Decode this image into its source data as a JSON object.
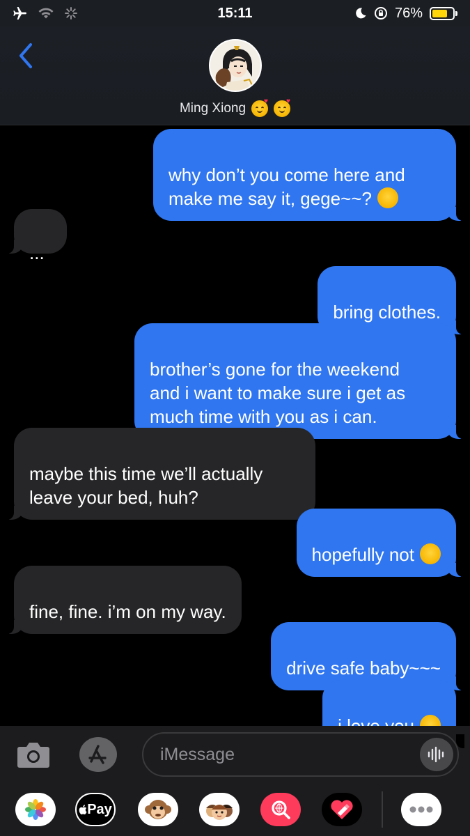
{
  "status_bar": {
    "time": "15:11",
    "battery_percent": "76%",
    "battery_level": 0.76,
    "icons": [
      "airplane-icon",
      "wifi-icon",
      "activity-spinner-icon",
      "moon-icon",
      "orientation-lock-icon",
      "battery-icon"
    ]
  },
  "header": {
    "contact_name": "Ming Xiong",
    "name_emojis": [
      "smiling-face-with-hearts",
      "smiling-face-with-hearts"
    ],
    "back_icon": "chevron-left-icon"
  },
  "messages": [
    {
      "side": "sent",
      "text": "why don’t you come here and\nmake me say it, gege~~?",
      "emoji": "smirking-face"
    },
    {
      "side": "received",
      "text": "..."
    },
    {
      "side": "sent",
      "text": "bring clothes."
    },
    {
      "side": "sent",
      "text": "brother’s gone for the weekend\nand i want to make sure i get as\nmuch time with you as i can."
    },
    {
      "side": "received",
      "text": "maybe this time we’ll actually\nleave your bed, huh?"
    },
    {
      "side": "sent",
      "text": "hopefully not",
      "emoji": "smiling-face-with-hearts"
    },
    {
      "side": "received",
      "text": "fine, fine. i’m on my way."
    },
    {
      "side": "sent",
      "text": "drive safe baby~~~"
    },
    {
      "side": "sent",
      "text": "i love you",
      "emoji": "face-blowing-a-kiss"
    }
  ],
  "input_bar": {
    "placeholder": "iMessage"
  },
  "app_drawer": {
    "apple_pay_label": "Pay",
    "apps": [
      "photos-icon",
      "apple-pay-icon",
      "animoji-icon",
      "memoji-icon",
      "image-search-icon",
      "digital-touch-icon",
      "more-icon"
    ]
  },
  "colors": {
    "sent_bubble": "#2f76f0",
    "received_bubble": "#262628",
    "accent": "#2f76f0",
    "background": "#000000"
  }
}
